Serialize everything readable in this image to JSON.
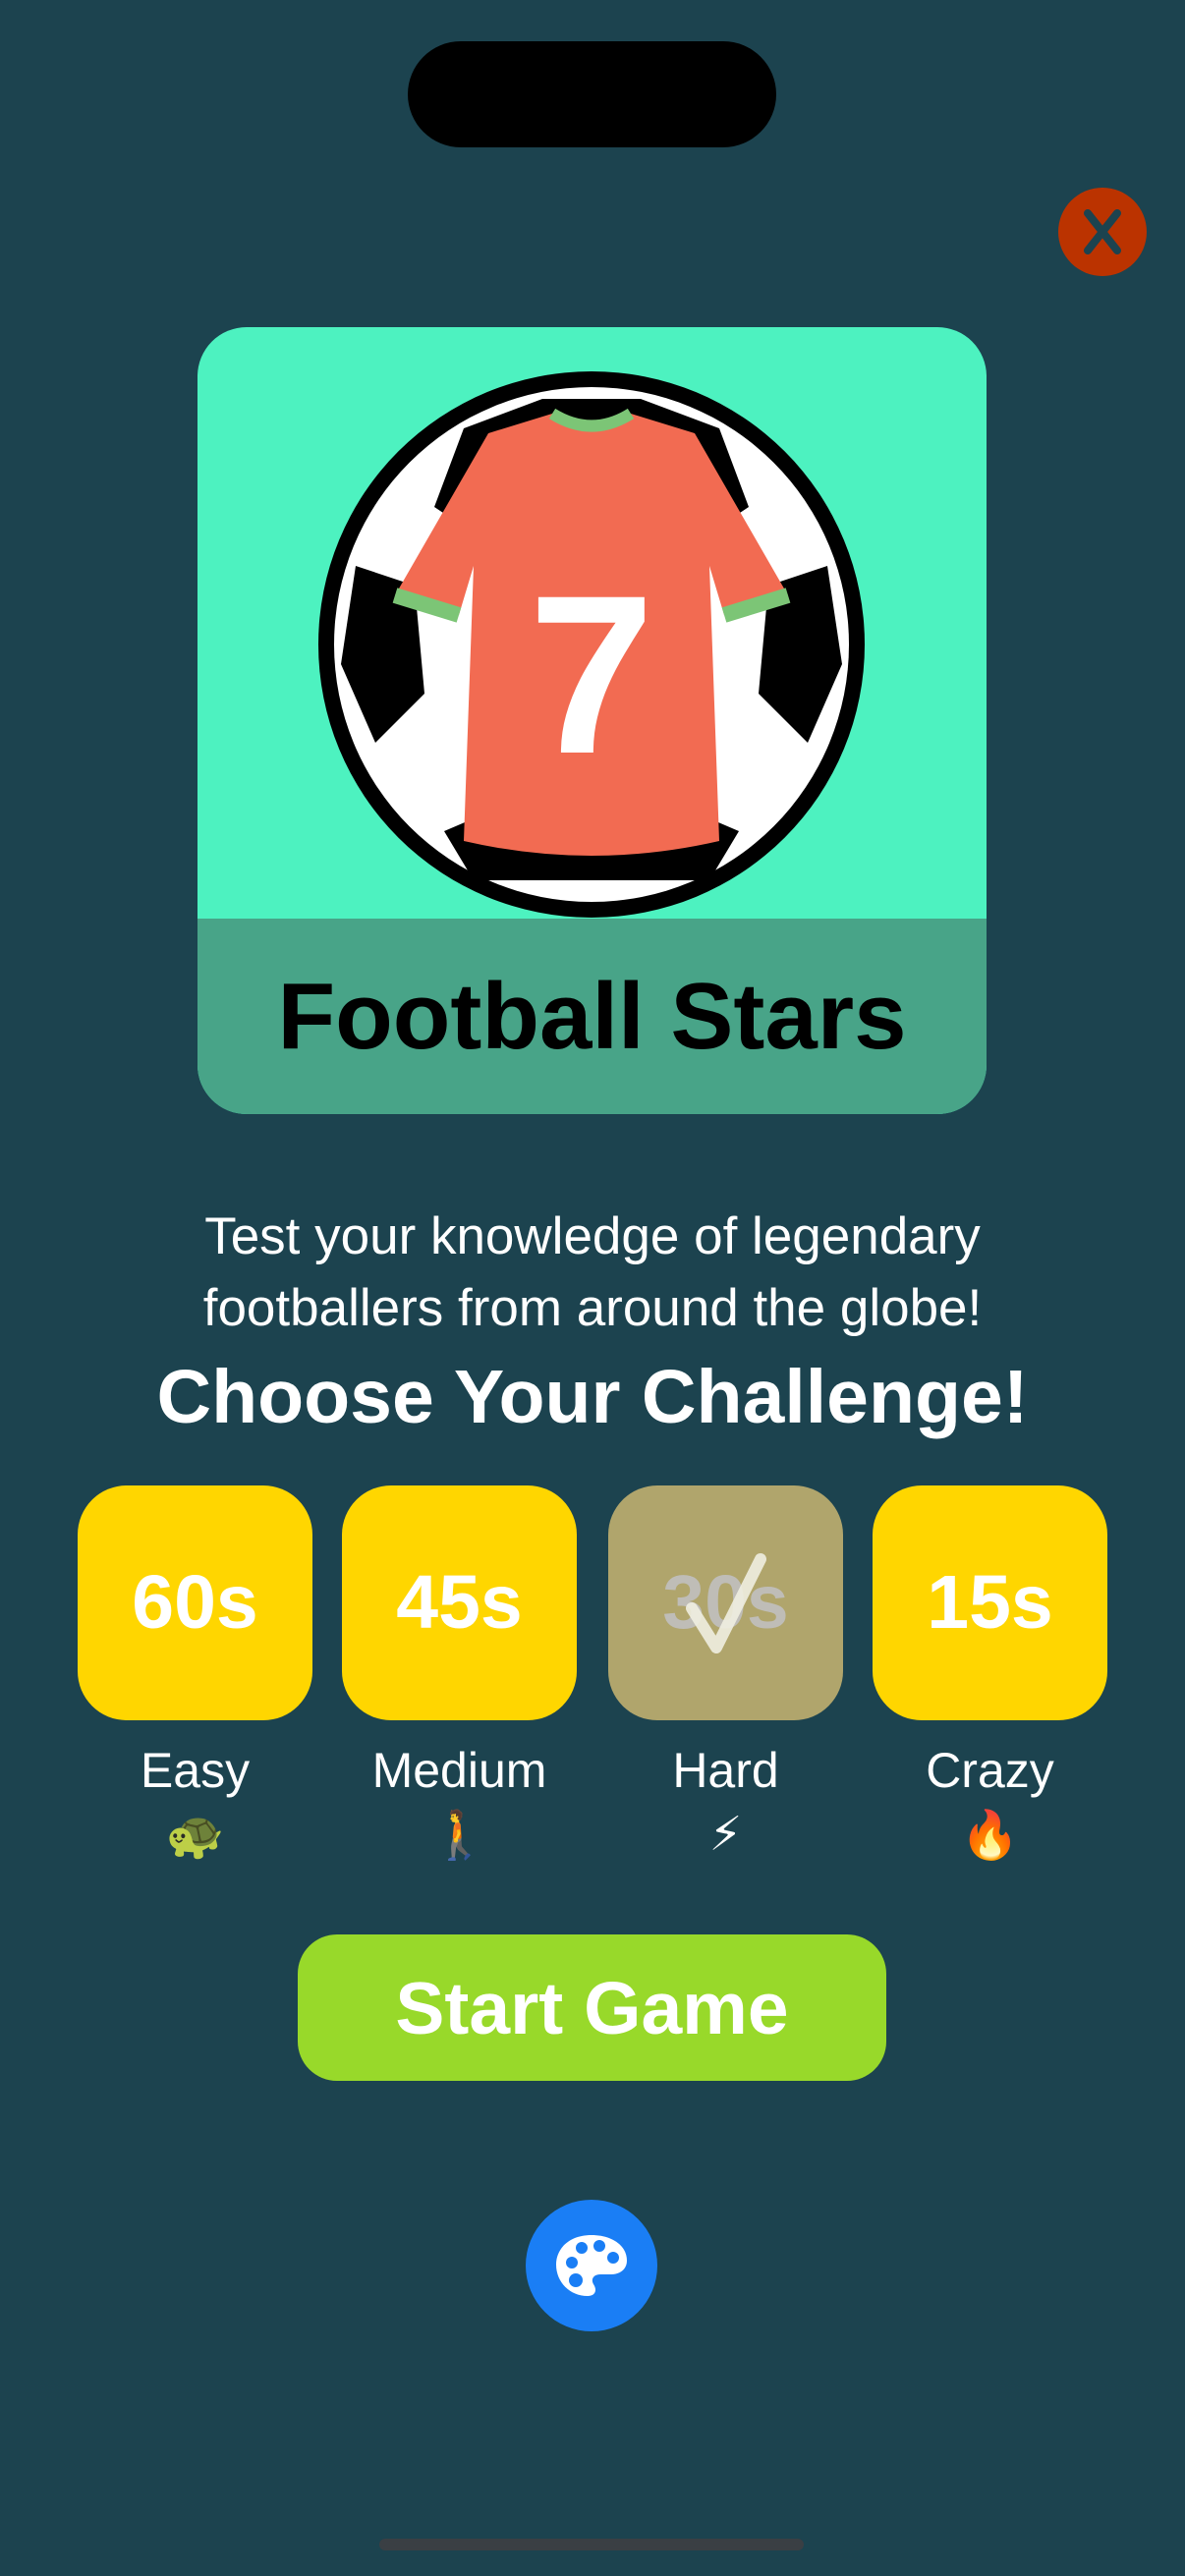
{
  "game": {
    "title": "Football Stars",
    "description_line1": "Test your knowledge of legendary",
    "description_line2": "footballers from around the globe!",
    "jersey_number": "7"
  },
  "challenge": {
    "heading": "Choose Your Challenge!",
    "options": [
      {
        "time": "60s",
        "label": "Easy",
        "emoji": "🐢",
        "selected": false
      },
      {
        "time": "45s",
        "label": "Medium",
        "emoji": "🚶",
        "selected": false
      },
      {
        "time": "30s",
        "label": "Hard",
        "emoji": "⚡",
        "selected": true
      },
      {
        "time": "15s",
        "label": "Crazy",
        "emoji": "🔥",
        "selected": false
      }
    ]
  },
  "actions": {
    "start": "Start Game",
    "close": "X"
  },
  "colors": {
    "background": "#1c434f",
    "option": "#ffd600",
    "selected": "#b0a56c",
    "start": "#98d92a",
    "close": "#bb3300",
    "palette": "#1a7ef5"
  }
}
